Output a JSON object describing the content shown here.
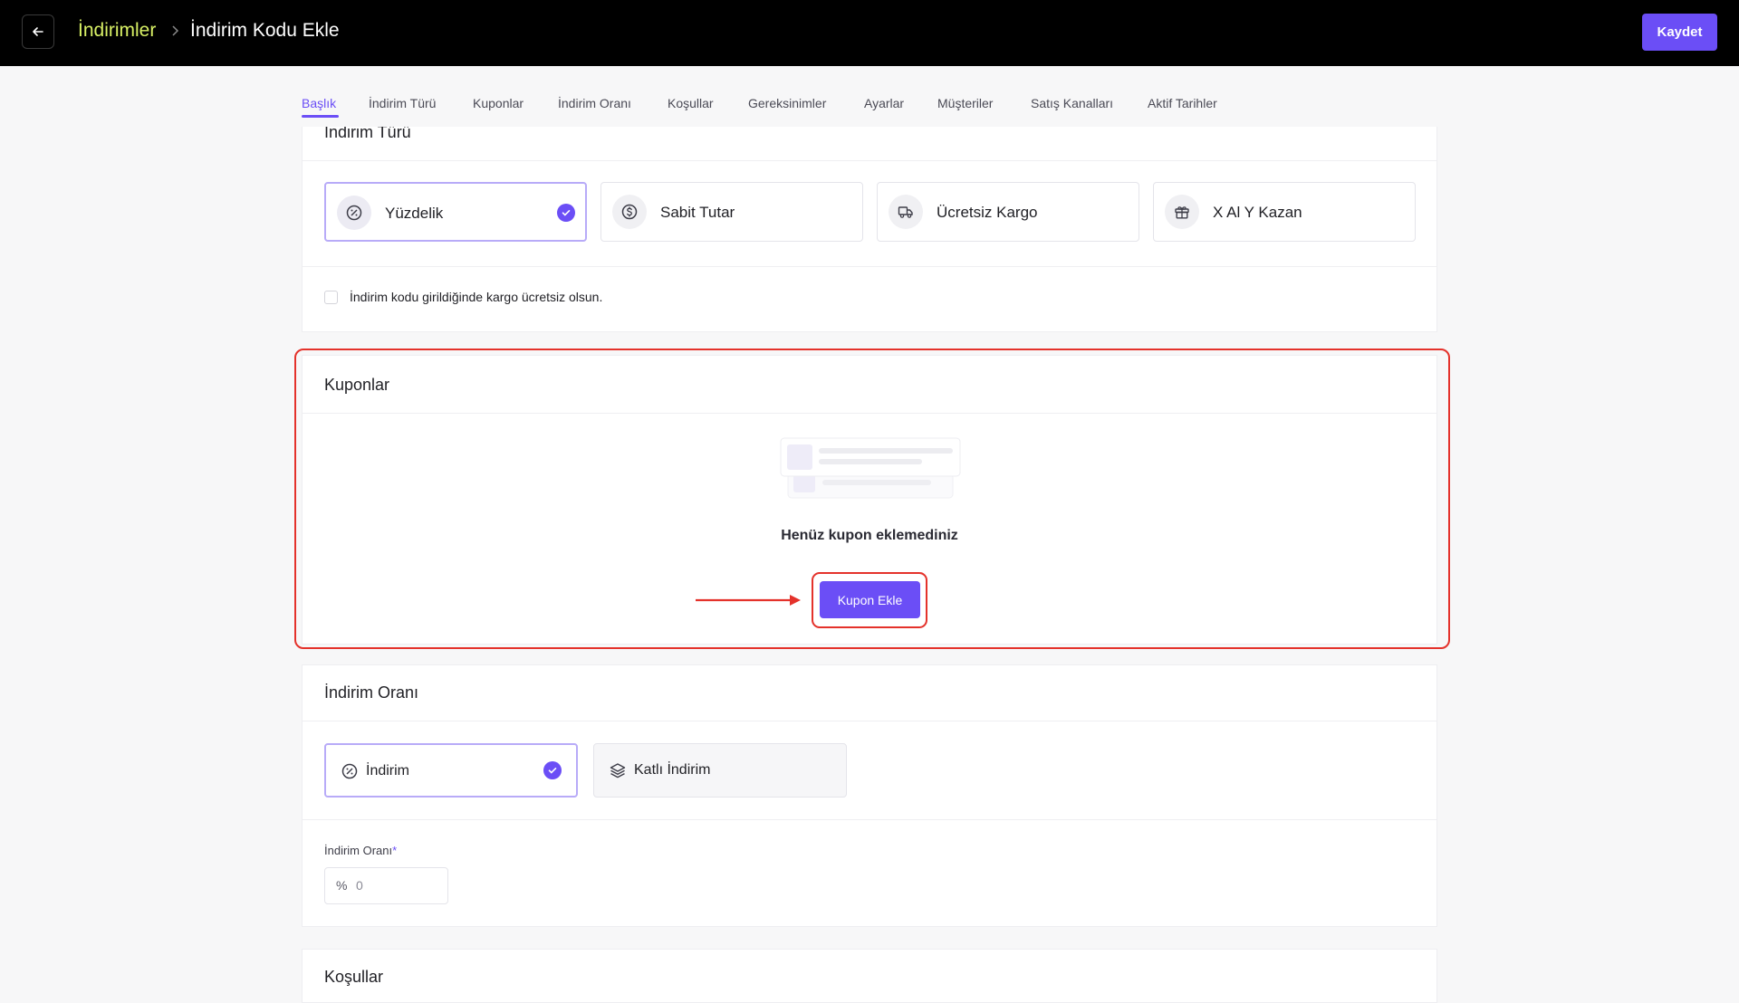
{
  "header": {
    "back_icon": "arrow-left-icon",
    "breadcrumb_root": "İndirimler",
    "breadcrumb_current": "İndirim Kodu Ekle",
    "save_label": "Kaydet"
  },
  "tabs": [
    {
      "label": "Başlık",
      "active": true
    },
    {
      "label": "İndirim Türü"
    },
    {
      "label": "Kuponlar"
    },
    {
      "label": "İndirim Oranı"
    },
    {
      "label": "Koşullar"
    },
    {
      "label": "Gereksinimler"
    },
    {
      "label": "Ayarlar"
    },
    {
      "label": "Müşteriler"
    },
    {
      "label": "Satış Kanalları"
    },
    {
      "label": "Aktif Tarihler"
    }
  ],
  "discount_type": {
    "title": "İndirim Türü",
    "options": [
      {
        "label": "Yüzdelik",
        "icon": "percent-icon",
        "selected": true
      },
      {
        "label": "Sabit Tutar",
        "icon": "dollar-icon"
      },
      {
        "label": "Ücretsiz Kargo",
        "icon": "truck-icon"
      },
      {
        "label": "X Al Y Kazan",
        "icon": "gift-icon"
      }
    ],
    "free_shipping_label": "İndirim kodu girildiğinde kargo ücretsiz olsun."
  },
  "coupons": {
    "title": "Kuponlar",
    "empty_text": "Henüz kupon eklemediniz",
    "add_label": "Kupon Ekle"
  },
  "discount_rate": {
    "title": "İndirim Oranı",
    "options": [
      {
        "label": "İndirim",
        "icon": "percent-icon",
        "selected": true
      },
      {
        "label": "Katlı İndirim",
        "icon": "layers-icon"
      }
    ],
    "field_label": "İndirim Oranı",
    "required_mark": "*",
    "prefix": "%",
    "placeholder": "0"
  },
  "conditions": {
    "title": "Koşullar"
  },
  "colors": {
    "accent": "#6b4ef6",
    "breadcrumb": "#d8f065",
    "annotation": "#e4322b"
  }
}
